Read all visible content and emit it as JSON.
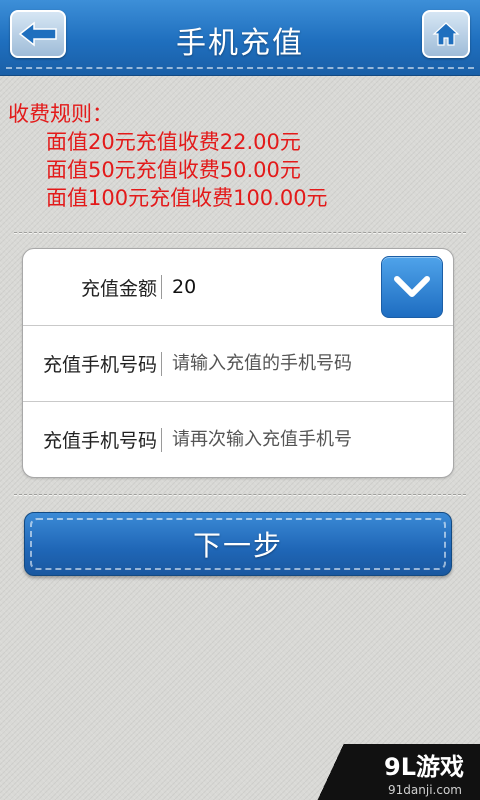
{
  "header": {
    "title": "手机充值",
    "back_icon": "back-arrow-icon",
    "home_icon": "home-icon"
  },
  "rules": {
    "title": "收费规则：",
    "lines": [
      "面值20元充值收费22.00元",
      "面值50元充值收费50.00元",
      "面值100元充值收费100.00元"
    ]
  },
  "form": {
    "amount_label": "充值金额",
    "amount_value": "20",
    "phone_label": "充值手机号码",
    "phone_placeholder": "请输入充值的手机号码",
    "phone_confirm_label": "充值手机号码",
    "phone_confirm_placeholder": "请再次输入充值手机号",
    "dropdown_icon": "chevron-down-icon"
  },
  "next_button": {
    "label": "下一步"
  },
  "watermark": {
    "logo": "9L游戏",
    "site": "91danji.com"
  },
  "colors": {
    "header_blue": "#1f6fbe",
    "rule_red": "#e31a1a",
    "button_blue": "#1f66b6",
    "background": "#d9d9d6"
  }
}
